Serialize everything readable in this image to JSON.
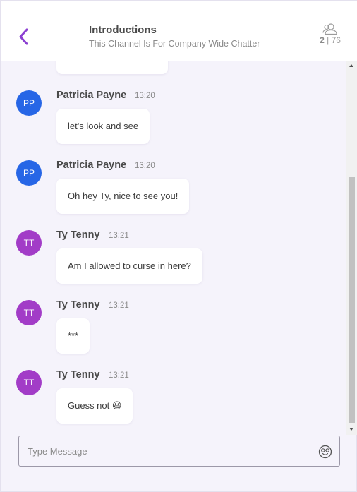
{
  "header": {
    "title": "Introductions",
    "subtitle": "This Channel Is For Company Wide Chatter",
    "members_online": "2",
    "members_separator": "|",
    "members_total": "76"
  },
  "messages": [
    {
      "initials": "PP",
      "author": "Patricia Payne",
      "time": "13:20",
      "text": "let's look and see"
    },
    {
      "initials": "PP",
      "author": "Patricia Payne",
      "time": "13:20",
      "text": "Oh hey Ty, nice to see you!"
    },
    {
      "initials": "TT",
      "author": "Ty Tenny",
      "time": "13:21",
      "text": "Am I allowed to curse in here?"
    },
    {
      "initials": "TT",
      "author": "Ty Tenny",
      "time": "13:21",
      "text": "***"
    },
    {
      "initials": "TT",
      "author": "Ty Tenny",
      "time": "13:21",
      "text": "Guess not 😆"
    }
  ],
  "composer": {
    "placeholder": "Type Message",
    "emoji_icon": "emoji-icon"
  },
  "colors": {
    "accent": "#8b3fd1",
    "pp_avatar": "#2766e6",
    "tt_avatar": "#a23cc7",
    "background": "#f5f3fb"
  }
}
